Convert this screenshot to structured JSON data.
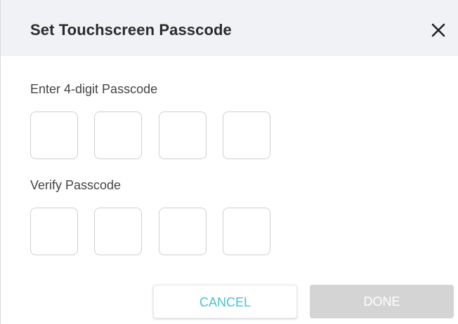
{
  "dialog": {
    "title": "Set Touchscreen Passcode",
    "close_icon": "close-icon"
  },
  "passcode": {
    "label": "Enter 4-digit Passcode",
    "digits": [
      "",
      "",
      "",
      ""
    ]
  },
  "verify": {
    "label": "Verify Passcode",
    "digits": [
      "",
      "",
      "",
      ""
    ]
  },
  "actions": {
    "cancel_label": "CANCEL",
    "done_label": "DONE",
    "done_enabled": false
  },
  "colors": {
    "header_bg": "#f0f2f5",
    "accent": "#4ac2cc",
    "disabled_bg": "#d4d4d4"
  }
}
